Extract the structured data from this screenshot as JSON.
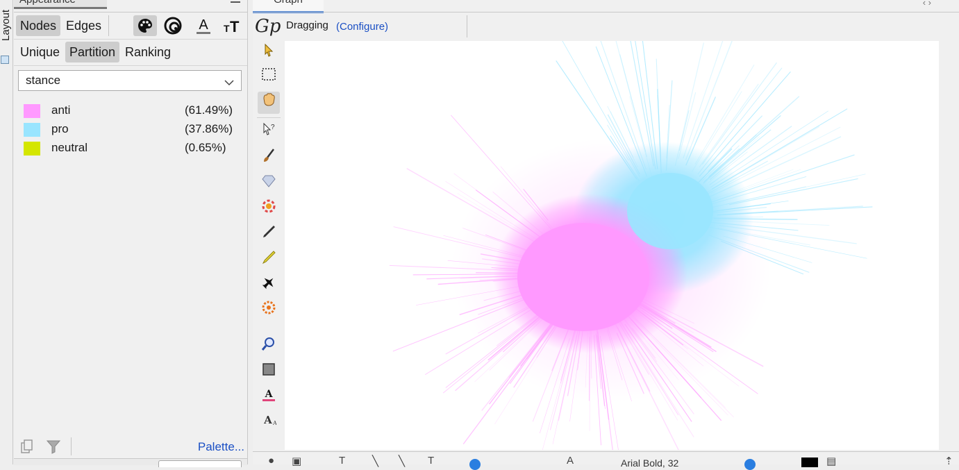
{
  "side_strip": {
    "label": "Layout"
  },
  "appearance": {
    "title": "Appearance",
    "target_tabs": [
      {
        "label": "Nodes",
        "active": true
      },
      {
        "label": "Edges",
        "active": false
      }
    ],
    "attribute_icons": [
      "palette-icon",
      "size-icon",
      "label-color-icon",
      "label-size-icon"
    ],
    "mode_tabs": [
      {
        "label": "Unique",
        "active": false
      },
      {
        "label": "Partition",
        "active": true
      },
      {
        "label": "Ranking",
        "active": false
      }
    ],
    "attribute_select": {
      "value": "stance"
    },
    "partition": [
      {
        "label": "anti",
        "percent": "(61.49%)",
        "color": "#ff99ff"
      },
      {
        "label": "pro",
        "percent": "(37.86%)",
        "color": "#99e5ff"
      },
      {
        "label": "neutral",
        "percent": "(0.65%)",
        "color": "#d4e600"
      }
    ],
    "palette_link": "Palette..."
  },
  "graph": {
    "tab_title": "Graph",
    "mode": "Dragging",
    "configure_link": "(Configure)",
    "tools": [
      "pointer-icon",
      "rectangle-select-icon",
      "drag-hand-icon",
      "edit-icon",
      "brush-icon",
      "diamond-icon",
      "color-wheel-icon",
      "pencil-icon",
      "highlighter-icon",
      "airplane-icon",
      "node-pie-icon",
      "zoom-icon",
      "square-icon",
      "font-color-icon",
      "font-size-icon"
    ],
    "bottom_text": "Arial Bold, 32",
    "colors": {
      "anti": "#ff99ff",
      "pro": "#99e5ff"
    }
  }
}
